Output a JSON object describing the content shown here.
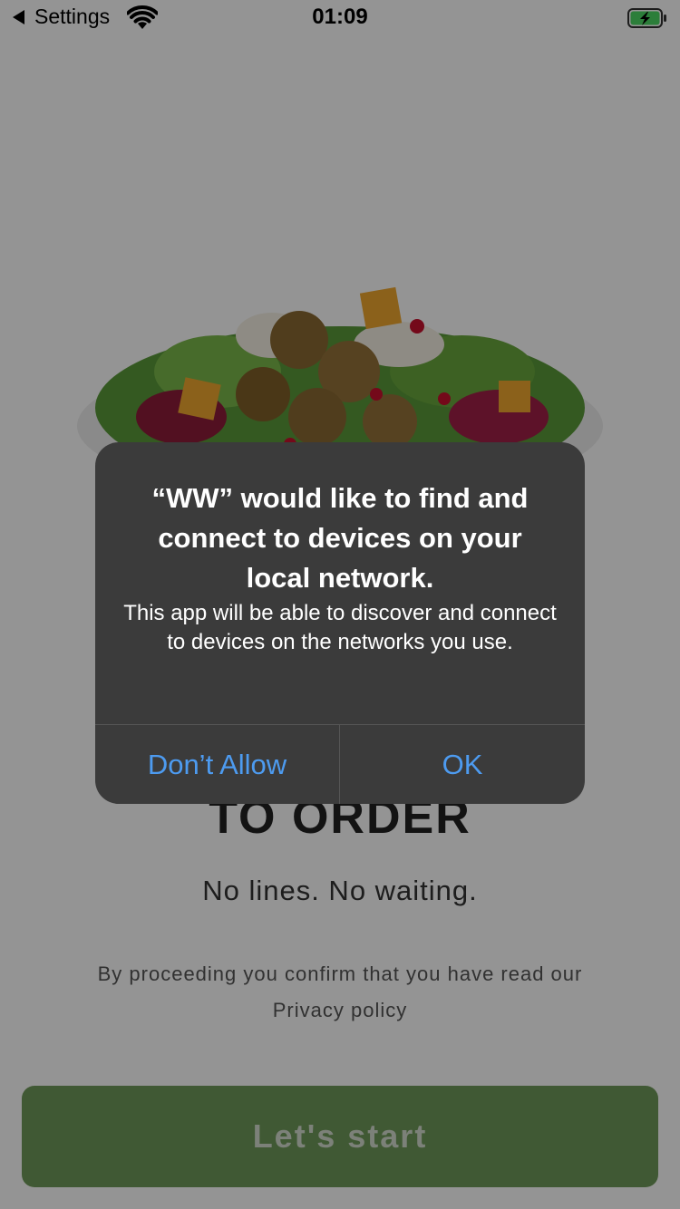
{
  "status_bar": {
    "back_label": "Settings",
    "time": "01:09",
    "icons": [
      "back-caret-icon",
      "wifi-icon",
      "battery-charging-icon"
    ]
  },
  "background": {
    "headline": "TO ORDER",
    "subline": "No lines. No waiting.",
    "legal_text": "By proceeding you confirm that you have read our",
    "privacy_link": "Privacy policy",
    "start_button": "Let's start"
  },
  "alert": {
    "title": "“WW” would like to find and connect to devices on your local network.",
    "message": "This app will be able to discover and connect to devices on the networks you use.",
    "deny_label": "Don’t Allow",
    "ok_label": "OK"
  },
  "colors": {
    "accent_button": "#6f9a5a",
    "alert_link": "#4d9bf0",
    "alert_background": "#3b3b3b",
    "battery_fill": "#4cd964"
  }
}
